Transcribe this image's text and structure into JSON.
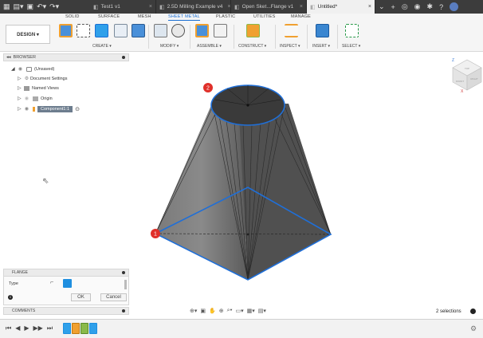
{
  "doc_tabs": [
    {
      "label": "Test1 v1",
      "active": false
    },
    {
      "label": "2.5D Milling Example v4",
      "active": false
    },
    {
      "label": "Open Sket...Flange v1",
      "active": false
    },
    {
      "label": "Untitled*",
      "active": true
    }
  ],
  "ribbon": {
    "tabs": [
      "SOLID",
      "SURFACE",
      "MESH",
      "SHEET METAL",
      "PLASTIC",
      "UTILITIES",
      "MANAGE"
    ],
    "active_tab": "SHEET METAL",
    "workspace_button": "DESIGN ▾",
    "groups": [
      "CREATE ▾",
      "MODIFY ▾",
      "ASSEMBLE ▾",
      "CONSTRUCT ▾",
      "INSPECT ▾",
      "INSERT ▾",
      "SELECT ▾"
    ]
  },
  "browser": {
    "title": "BROWSER",
    "root": "(Unsaved)",
    "items": [
      "Document Settings",
      "Named Views",
      "Origin",
      "Component1:1"
    ]
  },
  "flange": {
    "title": "FLANGE",
    "type_label": "Type",
    "ok": "OK",
    "cancel": "Cancel"
  },
  "comments": {
    "title": "COMMENTS"
  },
  "status": {
    "selections": "2 selections"
  },
  "viewcube": {
    "top": "TOP",
    "front": "FRONT",
    "right": "RIGHT",
    "z": "Z",
    "x": "X"
  },
  "markers": [
    "1",
    "2"
  ],
  "colors": {
    "accent": "#1a6fd4",
    "selection_edge": "#1f6fd8",
    "marker": "#e0302a",
    "body_dark": "#4e4e4e",
    "body_light": "#9a9a9a",
    "component_label": "#6d7d8e"
  }
}
